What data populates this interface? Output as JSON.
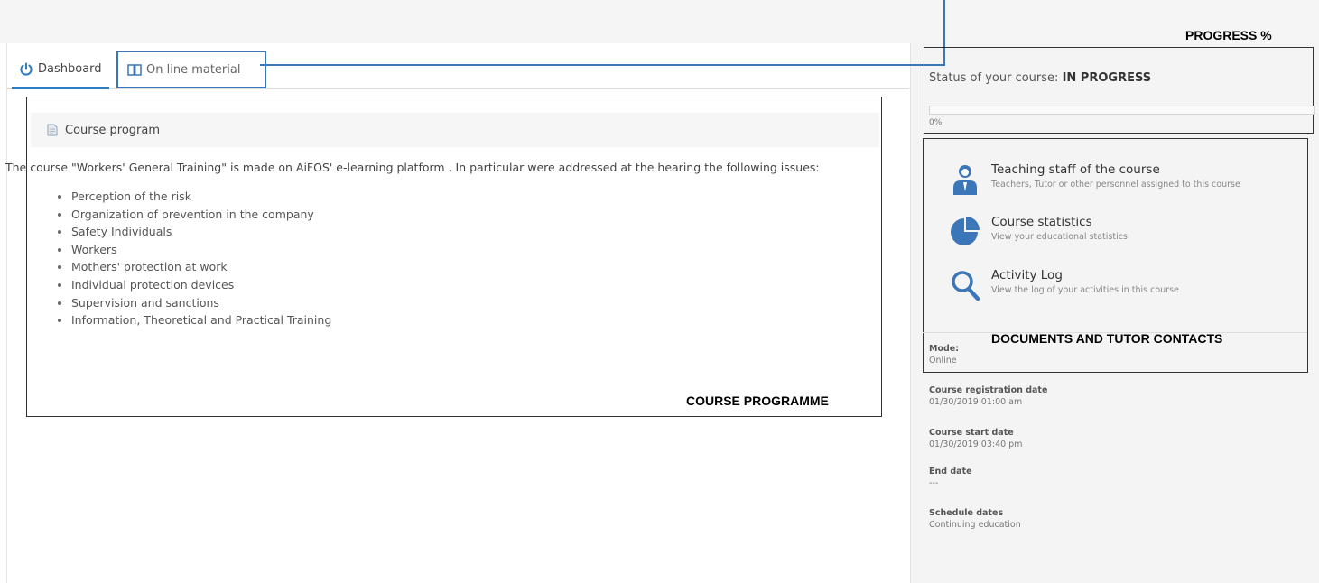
{
  "tabs": {
    "dashboard": "Dashboard",
    "online_material": "On line material"
  },
  "course_program": {
    "heading": "Course program",
    "intro": "The course \"Workers' General Training\" is made on AiFOS' e-learning platform . In particular were addressed at the hearing the following issues:",
    "items": [
      "Perception of the risk",
      "Organization of prevention in the company",
      "Safety Individuals",
      "Workers",
      "Mothers' protection at work",
      "Individual protection devices",
      "Supervision and sanctions",
      "Information, Theoretical and Practical Training"
    ],
    "annotation": "COURSE PROGRAMME"
  },
  "status": {
    "annotation": "PROGRESS %",
    "prefix": "Status of your course:",
    "value": "IN PROGRESS",
    "progress_percent_label": "0%",
    "progress_fraction": 0,
    "accent_color": "#3b77b8"
  },
  "documents": {
    "annotation": "DOCUMENTS AND TUTOR CONTACTS",
    "links": [
      {
        "title": "Teaching staff of the course",
        "subtitle": "Teachers, Tutor or other personnel assigned to this course",
        "icon": "teacher-icon"
      },
      {
        "title": "Course statistics",
        "subtitle": "View your educational statistics",
        "icon": "pie-chart-icon"
      },
      {
        "title": "Activity Log",
        "subtitle": "View the log of your activities in this course",
        "icon": "search-icon"
      }
    ]
  },
  "meta": {
    "mode_label": "Mode:",
    "mode_value": "Online",
    "registration_label": "Course registration date",
    "registration_value": "01/30/2019 01:00 am",
    "start_label": "Course start date",
    "start_value": "01/30/2019 03:40 pm",
    "end_label": "End date",
    "end_value": "---",
    "schedule_label": "Schedule dates",
    "schedule_value": "Continuing education"
  }
}
